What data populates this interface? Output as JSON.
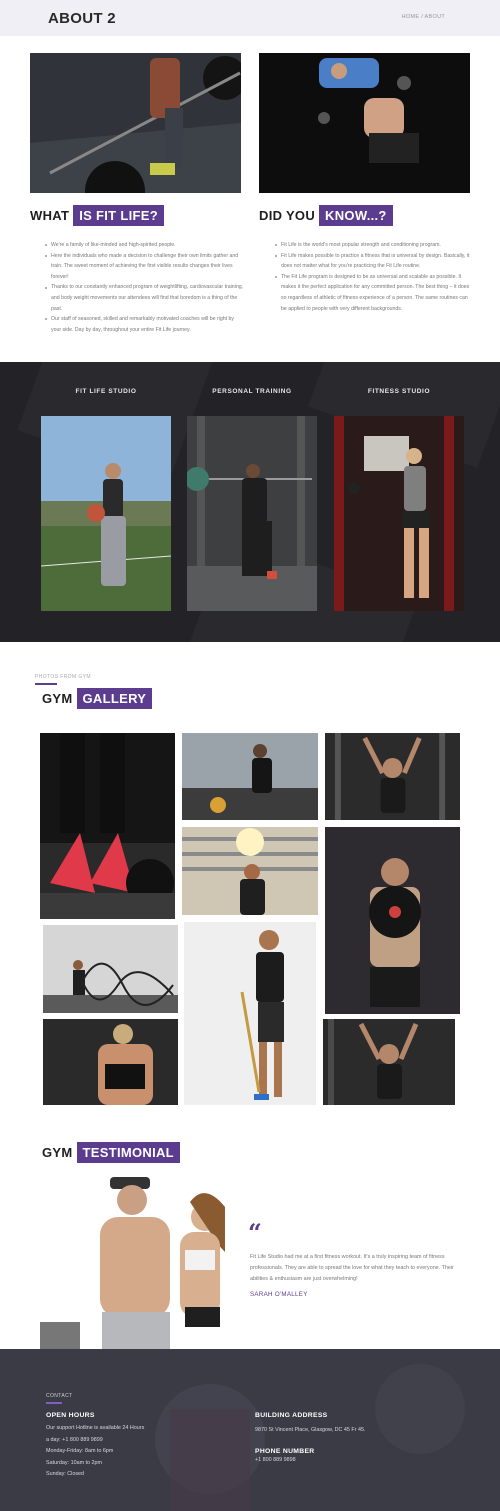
{
  "header": {
    "title": "ABOUT 2",
    "breadcrumb": "HOME / ABOUT"
  },
  "about": {
    "left": {
      "heading_plain": "WHAT",
      "heading_accent": "IS FIT LIFE?",
      "bullets": [
        "We're a family of like-minded and high-spirited people.",
        "Here the individuals who made a decision to challenge their own limits gather and train. The sweet moment of achieving the first visible results changes their lives forever!",
        "Thanks to our constantly enhanced program of weightlifting, cardiovascular training, and body weight movements our attendees will find that boredom is a thing of the past.",
        "Our staff of seasoned, skilled and remarkably motivated coaches will be right by your side. Day by day, throughout your entire Fit Life journey."
      ]
    },
    "right": {
      "heading_plain": "DID YOU",
      "heading_accent": "KNOW...?",
      "bullets": [
        "Fit Life is the world's most popular strength and conditioning program.",
        "Fit Life makes possible to practice a fitness that is universal by design. Basically, it does not matter what for you're practicing the Fit Life routine.",
        "The Fit Life program is designed to be as universal and scalable as possible. It makes it the perfect application for any committed person. The best thing – it does so regardless of athletic of fitness experience of a person. The same routines can be applied to people with very different backgrounds."
      ]
    }
  },
  "studios": [
    {
      "label": "FIT LIFE STUDIO"
    },
    {
      "label": "PERSONAL TRAINING"
    },
    {
      "label": "FITNESS STUDIO"
    }
  ],
  "gallery": {
    "small_label": "PHOTOS FROM GYM",
    "heading_plain": "GYM",
    "heading_accent": "GALLERY"
  },
  "testimonial": {
    "heading_plain": "GYM",
    "heading_accent": "TESTIMONIAL",
    "quote_mark": "“",
    "quote_lines": [
      "Fit Life Studio had me at a first fitness workout. It's a truly inspiring team of fitness",
      "professionals. They are able to spread the love for what they teach to everyone. Their",
      "abilities & enthusiasm are just overwhelming!"
    ],
    "author": "SARAH O'MALLEY"
  },
  "footer": {
    "small_label": "CONTACT",
    "hours_title": "OPEN HOURS",
    "hours_lines": [
      "Our support Hotline is available 24 Hours",
      "a day: +1 800 889 9899",
      "Monday-Friday: 8am to 6pm",
      "Saturday: 10am to 2pm",
      "Sunday: Closed"
    ],
    "address_title": "BUILDING ADDRESS",
    "address": "9870 St Vincent Place, Glasgow, DC 45 Fr 45.",
    "phone_title": "PHONE NUMBER",
    "phone": "+1 800 889 9898"
  },
  "colors": {
    "accent": "#5c3c8e",
    "dark_section": "#232227",
    "footer": "#3b3b46",
    "header_bg": "#efeff5"
  }
}
